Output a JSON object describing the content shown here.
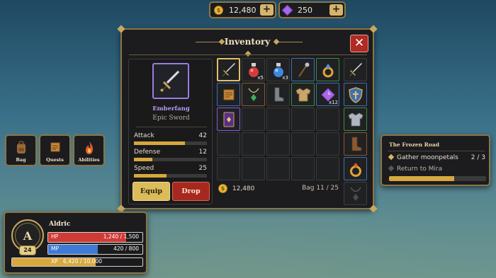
{
  "currencies": [
    {
      "icon": "gold-coin-icon",
      "value": "12,480",
      "add": "+"
    },
    {
      "icon": "purple-gem-icon",
      "value": "250",
      "add": "+"
    }
  ],
  "inventory": {
    "title": "Inventory",
    "close": "✕",
    "selected_item": {
      "icon": "sword-icon",
      "name": "Emberfang",
      "type": "Epic Sword",
      "rarity_color": "#b79cf2"
    },
    "stats": [
      {
        "label": "Attack",
        "value": "42",
        "fill": 0.7
      },
      {
        "label": "Defense",
        "value": "12",
        "fill": 0.25
      },
      {
        "label": "Speed",
        "value": "25",
        "fill": 0.45
      }
    ],
    "buttons": {
      "equip": "Equip",
      "drop": "Drop"
    },
    "slots": [
      {
        "icon": "sword-icon",
        "count": "",
        "border": "#e3c06a"
      },
      {
        "icon": "red-potion-icon",
        "count": "x5",
        "border": "#3a3a3a"
      },
      {
        "icon": "blue-potion-icon",
        "count": "x3",
        "border": "#3a3a3a"
      },
      {
        "icon": "staff-icon",
        "count": "",
        "border": "#3f6fb5"
      },
      {
        "icon": "gold-ring-icon",
        "count": "",
        "border": "#3c8a4a"
      },
      {
        "icon": "scroll-icon",
        "count": "",
        "border": "#3f6fb5"
      },
      {
        "icon": "amulet-icon",
        "count": "",
        "border": "#8a5a2e"
      },
      {
        "icon": "boot-icon",
        "count": "",
        "border": "#3a3a3a"
      },
      {
        "icon": "tunic-icon",
        "count": "",
        "border": "#3c8a4a"
      },
      {
        "icon": "purple-gem-icon",
        "count": "x12",
        "border": "#3f6fb5"
      },
      {
        "icon": "spellbook-icon",
        "count": "",
        "border": "#8a5ad9"
      },
      {
        "icon": "",
        "count": "",
        "border": "#3a3a3a"
      },
      {
        "icon": "",
        "count": "",
        "border": "#3a3a3a"
      },
      {
        "icon": "",
        "count": "",
        "border": "#3a3a3a"
      },
      {
        "icon": "",
        "count": "",
        "border": "#3a3a3a"
      },
      {
        "icon": "",
        "count": "",
        "border": "#3a3a3a"
      },
      {
        "icon": "",
        "count": "",
        "border": "#3a3a3a"
      },
      {
        "icon": "",
        "count": "",
        "border": "#3a3a3a"
      },
      {
        "icon": "",
        "count": "",
        "border": "#3a3a3a"
      },
      {
        "icon": "",
        "count": "",
        "border": "#3a3a3a"
      },
      {
        "icon": "",
        "count": "",
        "border": "#3a3a3a"
      },
      {
        "icon": "",
        "count": "",
        "border": "#3a3a3a"
      },
      {
        "icon": "",
        "count": "",
        "border": "#3a3a3a"
      },
      {
        "icon": "",
        "count": "",
        "border": "#3a3a3a"
      },
      {
        "icon": "",
        "count": "",
        "border": "#3a3a3a"
      }
    ],
    "gold": "12,480",
    "bag_capacity": "Bag 11 / 25",
    "equipment": [
      "sword-icon",
      "shield-icon",
      "chestplate-icon",
      "boot-icon",
      "ring-icon",
      "amulet-empty-icon"
    ]
  },
  "quick_buttons": [
    {
      "label": "Bag",
      "icon": "backpack-icon"
    },
    {
      "label": "Quests",
      "icon": "scroll-icon"
    },
    {
      "label": "Abilities",
      "icon": "flame-icon"
    }
  ],
  "quest": {
    "title": "The Frozen Road",
    "objectives": [
      {
        "text": "Gather moonpetals",
        "progress": "2 / 3",
        "done": false
      },
      {
        "text": "Return to Mira",
        "progress": "",
        "done": false
      }
    ],
    "progress": 0.67
  },
  "player": {
    "name": "Aldric",
    "emblem": "A",
    "level": "24",
    "hp": {
      "label": "HP",
      "value": "1,240 / 1,500",
      "fill": 0.827
    },
    "mp": {
      "label": "MP",
      "value": "420 / 800",
      "fill": 0.525
    },
    "xp": {
      "label": "XP",
      "value": "6,420 / 10,000",
      "fill": 0.642
    }
  },
  "colors": {
    "gold": "#d6b46a",
    "frame": "#8a7645",
    "hp": "#cf3b36",
    "mp": "#3f7ad6",
    "xp": "#d6a83d"
  }
}
